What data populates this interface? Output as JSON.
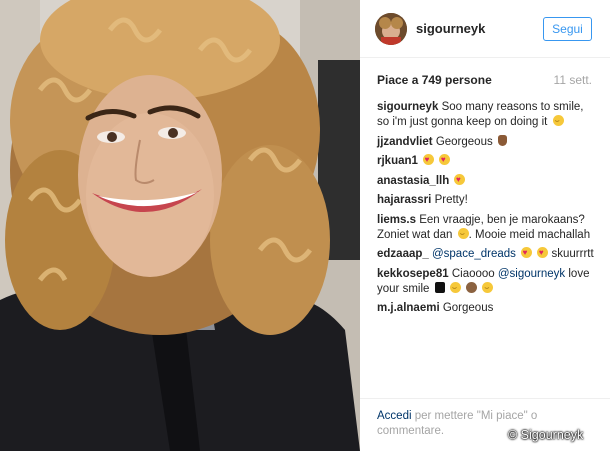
{
  "post": {
    "username": "sigourneyk",
    "follow_label": "Segui",
    "likes": "Piace a 749 persone",
    "time": "11 sett."
  },
  "comments": [
    {
      "author": "sigourneyk",
      "text": "Soo many reasons to smile, so i'm just gonna keep on doing it",
      "emojis": [
        "smile"
      ]
    },
    {
      "author": "jjzandvliet",
      "text": "Georgeous",
      "emojis": [
        "hand"
      ]
    },
    {
      "author": "rjkuan1",
      "text": "",
      "emojis": [
        "heart",
        "heart"
      ]
    },
    {
      "author": "anastasia_llh",
      "text": "",
      "emojis": [
        "heart"
      ]
    },
    {
      "author": "hajarassri",
      "text": "Pretty!",
      "emojis": []
    },
    {
      "author": "liems.s",
      "text": "Een vraagje, ben je marokaans? Zoniet wat dan",
      "text2": ". Mooie meid machallah",
      "emojis": [
        "smile"
      ]
    },
    {
      "author": "edzaaap_",
      "mention": "@space_dreads",
      "text": "skuurrrtt",
      "emojis": [
        "heart",
        "heart"
      ]
    },
    {
      "author": "kekkosepe81",
      "text": "Ciaoooo",
      "mention": "@sigourneyk",
      "text2": "love your smile",
      "emojis": [
        "top",
        "smile",
        "monkey",
        "smile"
      ]
    },
    {
      "author": "m.j.alnaemi",
      "text": "Gorgeous",
      "emojis": []
    }
  ],
  "footer": {
    "login_link": "Accedi",
    "login_text": "per mettere \"Mi piace\" o commentare."
  },
  "watermark": "© Sigourneyk",
  "colors": {
    "accent": "#3897f0",
    "link": "#003569",
    "muted": "#a5a5a5"
  }
}
